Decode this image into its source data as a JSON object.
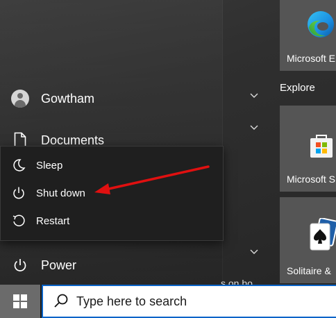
{
  "start_menu": {
    "user": {
      "name": "Gowtham",
      "icon": "person-icon"
    },
    "documents": {
      "label": "Documents",
      "icon": "document-icon"
    },
    "power": {
      "label": "Power",
      "icon": "power-icon"
    },
    "scroll_text": "s on ho"
  },
  "power_menu": {
    "items": [
      {
        "label": "Sleep",
        "icon": "moon-icon"
      },
      {
        "label": "Shut down",
        "icon": "power-icon"
      },
      {
        "label": "Restart",
        "icon": "restart-icon"
      }
    ],
    "annotation_arrow_color": "#e01010"
  },
  "tiles": {
    "group_label": "Explore",
    "items": [
      {
        "label": "Microsoft E",
        "icon": "edge-icon"
      },
      {
        "label": "Microsoft S",
        "icon": "store-icon"
      },
      {
        "label": "Solitaire &",
        "icon": "solitaire-icon"
      }
    ]
  },
  "taskbar": {
    "search_placeholder": "Type here to search",
    "accent": "#0a64c8"
  }
}
